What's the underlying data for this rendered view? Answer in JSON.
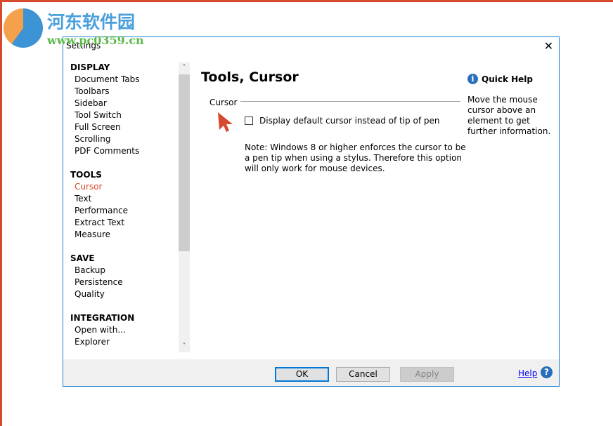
{
  "watermark": {
    "cn": "河东软件园",
    "url": "www.pc0359.cn"
  },
  "dialog": {
    "title": "Settings",
    "close": "✕"
  },
  "nav": [
    {
      "section": "DISPLAY",
      "items": [
        "Document Tabs",
        "Toolbars",
        "Sidebar",
        "Tool Switch",
        "Full Screen",
        "Scrolling",
        "PDF Comments"
      ]
    },
    {
      "section": "TOOLS",
      "items": [
        "Cursor",
        "Text",
        "Performance",
        "Extract Text",
        "Measure"
      ]
    },
    {
      "section": "SAVE",
      "items": [
        "Backup",
        "Persistence",
        "Quality"
      ]
    },
    {
      "section": "INTEGRATION",
      "items": [
        "Open with...",
        "Explorer"
      ]
    }
  ],
  "active_item": "Cursor",
  "main": {
    "heading": "Tools, Cursor",
    "group": "Cursor",
    "checkbox_label": "Display default cursor instead of tip of pen",
    "checkbox_checked": false,
    "note": "Note: Windows 8 or higher enforces the cursor to be a pen tip when using a stylus. Therefore this option will only work for mouse devices."
  },
  "quick_help": {
    "title": "Quick Help",
    "icon": "i",
    "text": "Move the mouse cursor above an element to get further information."
  },
  "footer": {
    "ok": "OK",
    "cancel": "Cancel",
    "apply": "Apply",
    "help": "Help",
    "help_icon": "?"
  },
  "colors": {
    "accent": "#d64a2e",
    "border": "#1a7fd4",
    "info": "#2a6ebb"
  }
}
